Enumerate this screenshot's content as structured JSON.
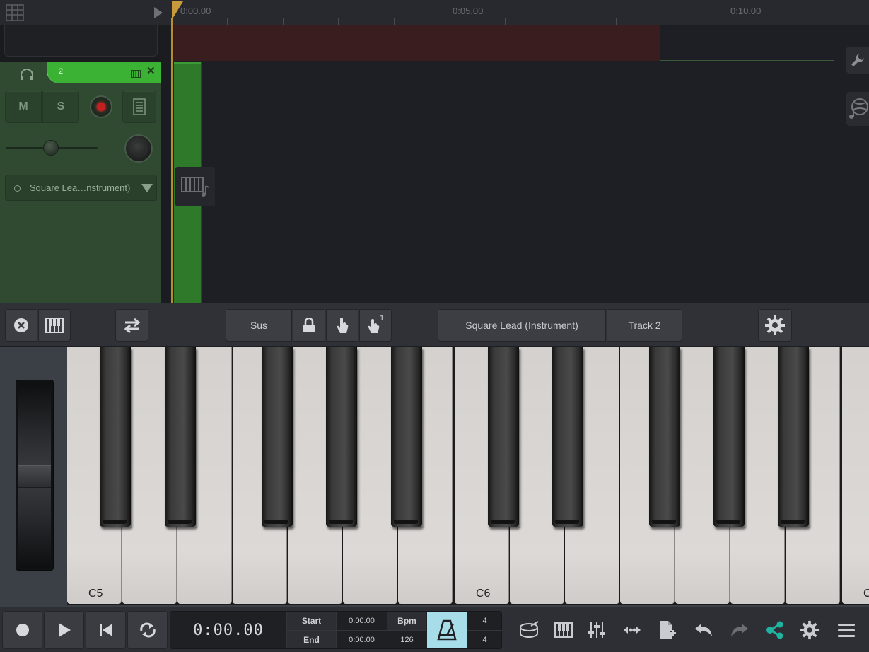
{
  "ruler": {
    "labels": [
      "0:00.00",
      "0:05.00",
      "0:10.00"
    ]
  },
  "track": {
    "number": "2",
    "mute_label": "M",
    "solo_label": "S",
    "instrument_label": "Square Lea…nstrument)"
  },
  "keyboard_toolbar": {
    "sus_label": "Sus",
    "touch_count": "1",
    "instrument_name": "Square Lead (Instrument)",
    "track_name": "Track 2"
  },
  "keyboard": {
    "note_labels": [
      "C5",
      "C6",
      "C"
    ]
  },
  "transport": {
    "time": "0:00.00",
    "start_label": "Start",
    "start_value": "0:00.00",
    "end_label": "End",
    "end_value": "0:00.00",
    "bpm_label": "Bpm",
    "bpm_value": "126",
    "time_sig_top": "4",
    "time_sig_bottom": "4"
  },
  "colors": {
    "track_green": "#3cb234",
    "record_red": "#c4201f",
    "metronome_active": "#a7dce9",
    "share_accent": "#1fb3a0",
    "playhead": "#c79a3c"
  },
  "icons": {
    "grid": "grid-icon",
    "headphones": "headphones-icon",
    "wrench": "wrench-icon",
    "globe": "globe-music-icon",
    "instrument": "keyboard-note-icon",
    "close": "close-circle-icon",
    "piano": "piano-icon",
    "swap": "swap-arrows-icon",
    "lock": "lock-icon",
    "touch": "touch-icon",
    "settings": "gear-icon",
    "metronome": "metronome-icon",
    "drum": "drum-icon",
    "mixer": "mixer-sliders-icon",
    "split": "split-arrows-icon",
    "add_file": "add-file-icon",
    "undo": "undo-icon",
    "redo": "redo-icon",
    "share": "share-icon",
    "menu": "hamburger-menu-icon"
  }
}
